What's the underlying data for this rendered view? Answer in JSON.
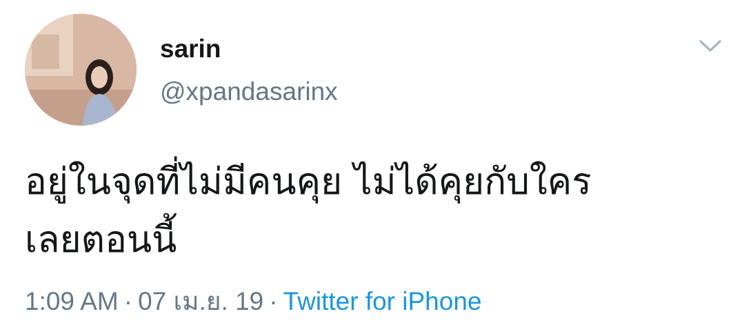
{
  "tweet": {
    "display_name": "sarin",
    "handle": "@xpandasarinx",
    "text": "อยู่ในจุดที่ไม่มีคนคุย ไม่ได้คุยกับใคร\nเลยตอนนี้",
    "time": "1:09 AM",
    "separator": "·",
    "date": "07 เม.ย. 19",
    "source": "Twitter for iPhone"
  },
  "icons": {
    "menu": "chevron-down-icon"
  },
  "colors": {
    "text": "#14171a",
    "secondary": "#657786",
    "link": "#1b95e0"
  }
}
